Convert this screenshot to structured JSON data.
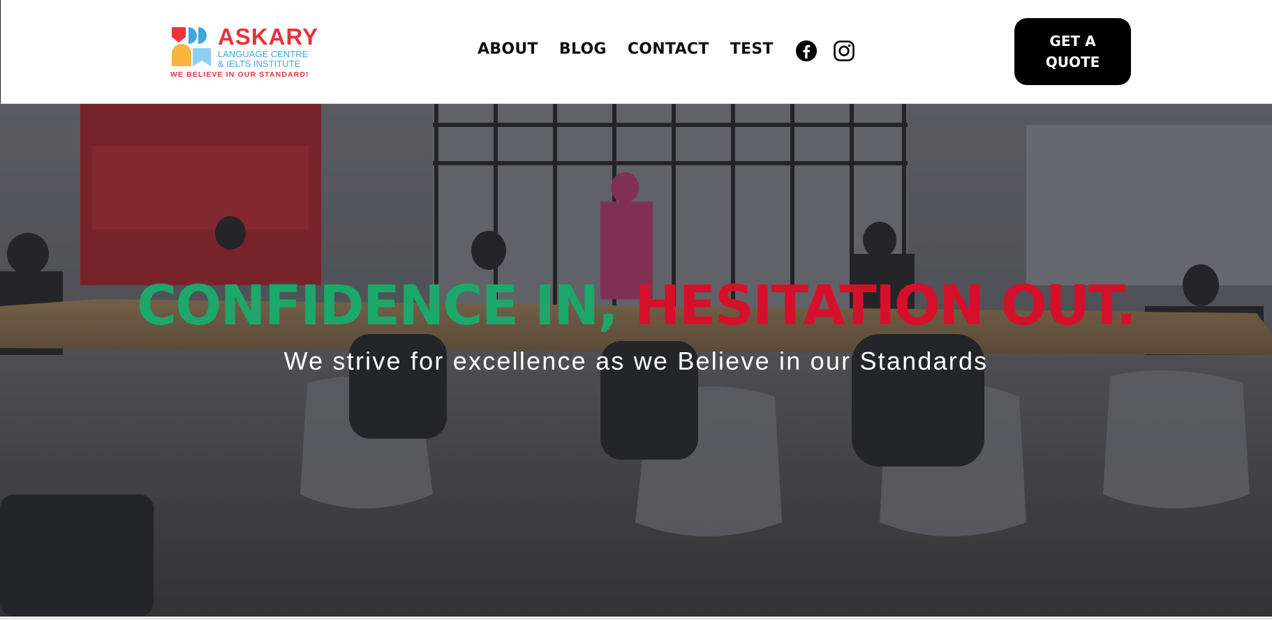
{
  "logo": {
    "name": "ASKARY",
    "line1": "LANGUAGE CENTRE",
    "line2": "& IELTS INSTITUTE",
    "tagline": "WE BELIEVE IN OUR STANDARD!"
  },
  "nav": {
    "items": [
      "ABOUT",
      "BLOG",
      "CONTACT",
      "TEST"
    ]
  },
  "social": {
    "icons": [
      "facebook-icon",
      "instagram-icon"
    ]
  },
  "cta": {
    "line1": "GET A",
    "line2": "QUOTE"
  },
  "hero": {
    "headline_green": "CONFIDENCE IN,",
    "headline_red": " HESITATION OUT.",
    "subline": "We strive for excellence as we Believe in our Standards"
  },
  "colors": {
    "brand_red": "#e8323c",
    "brand_blue": "#3ea6e0",
    "headline_green": "#1ca86a",
    "headline_red": "#d6102b",
    "cta_bg": "#000000"
  }
}
